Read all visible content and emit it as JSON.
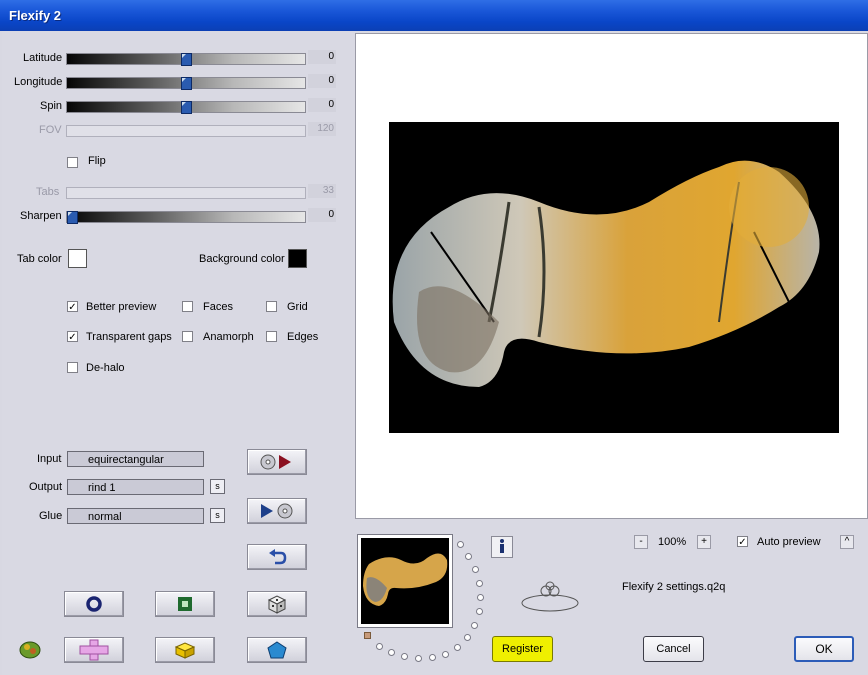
{
  "window": {
    "title": "Flexify 2"
  },
  "params": {
    "latitude": {
      "label": "Latitude",
      "value": "0",
      "position": 0.5,
      "enabled": true
    },
    "longitude": {
      "label": "Longitude",
      "value": "0",
      "position": 0.5,
      "enabled": true
    },
    "spin": {
      "label": "Spin",
      "value": "0",
      "position": 0.5,
      "enabled": true
    },
    "fov": {
      "label": "FOV",
      "value": "120",
      "enabled": false
    },
    "tabs": {
      "label": "Tabs",
      "value": "33",
      "enabled": false
    },
    "sharpen": {
      "label": "Sharpen",
      "value": "0",
      "position": 0.0,
      "enabled": true
    }
  },
  "flip": {
    "label": "Flip",
    "checked": false
  },
  "colors": {
    "tab_color_label": "Tab color",
    "tab_color": "#ffffff",
    "background_color_label": "Background color",
    "background_color": "#000000"
  },
  "options": {
    "better_preview": {
      "label": "Better preview",
      "checked": true
    },
    "faces": {
      "label": "Faces",
      "checked": false
    },
    "grid": {
      "label": "Grid",
      "checked": false
    },
    "transparent_gaps": {
      "label": "Transparent gaps",
      "checked": true
    },
    "anamorph": {
      "label": "Anamorph",
      "checked": false
    },
    "edges": {
      "label": "Edges",
      "checked": false
    },
    "de_halo": {
      "label": "De-halo",
      "checked": false
    }
  },
  "projection": {
    "input_label": "Input",
    "input_value": "equirectangular",
    "output_label": "Output",
    "output_value": "rind 1",
    "glue_label": "Glue",
    "glue_value": "normal",
    "s_label": "s"
  },
  "icons": {
    "load": "disc-play-icon",
    "save": "play-disc-icon",
    "undo": "undo-arrow-icon",
    "ring": "ring-icon",
    "square": "square-frame-icon",
    "dice": "dice-icon",
    "app": "flexify-logo-icon",
    "cross": "cross-shape-icon",
    "cube": "cube-icon",
    "pentagon": "pentagon-icon",
    "info": "info-icon",
    "signature": "signature-logo"
  },
  "zoom": {
    "minus": "-",
    "value": "100%",
    "plus": "+"
  },
  "auto_preview": {
    "label": "Auto preview",
    "checked": true,
    "scroll": "^"
  },
  "settings_file": "Flexify 2 settings.q2q",
  "buttons": {
    "register": "Register",
    "cancel": "Cancel",
    "ok": "OK"
  },
  "accent": {
    "titlebar": "#1a57d8",
    "register": "#efef00",
    "ok_border": "#2c5cb8"
  }
}
